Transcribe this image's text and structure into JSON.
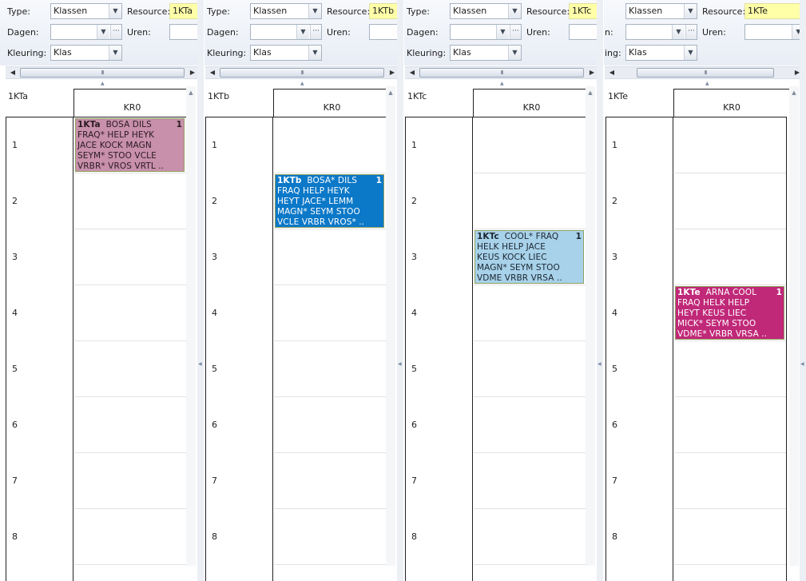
{
  "labels": {
    "type": "Type:",
    "resource": "Resource:",
    "dagen": "Dagen:",
    "uren": "Uren:",
    "kleuring": "Kleuring:"
  },
  "slots": [
    "1",
    "2",
    "3",
    "4",
    "5",
    "6",
    "7",
    "8"
  ],
  "panes": [
    {
      "type_value": "Klassen",
      "resource_value": "1KTa",
      "kleuring_value": "Klas",
      "resource_name": "1KTa",
      "column_header": "KR0",
      "lesson": {
        "slot_index": 0,
        "color": "#c890aa",
        "text_color": "#2a1a22",
        "class": "1KTa",
        "first_line": "BOSA  DILS",
        "count": "1",
        "lines": [
          "FRAQ*  HELP  HEYK",
          "JACE  KOCK  MAGN",
          "SEYM*  STOO  VCLE",
          "VRBR*  VROS  VRTL  .."
        ]
      }
    },
    {
      "type_value": "Klassen",
      "resource_value": "1KTb",
      "kleuring_value": "Klas",
      "resource_name": "1KTb",
      "column_header": "KR0",
      "lesson": {
        "slot_index": 1,
        "color": "#0b78c8",
        "text_color": "#ffffff",
        "class": "1KTb",
        "first_line": "BOSA*  DILS",
        "count": "1",
        "lines": [
          "FRAQ  HELP  HEYK",
          "HEYT  JACE*  LEMM",
          "MAGN*  SEYM  STOO",
          "VCLE  VRBR  VROS*  .."
        ]
      }
    },
    {
      "type_value": "Klassen",
      "resource_value": "1KTc",
      "kleuring_value": "Klas",
      "resource_name": "1KTc",
      "column_header": "KR0",
      "lesson": {
        "slot_index": 2,
        "color": "#a8d2ea",
        "text_color": "#1b2630",
        "class": "1KTc",
        "first_line": "COOL*  FRAQ",
        "count": "1",
        "lines": [
          "HELK  HELP  JACE",
          "KEUS  KOCK  LIEC",
          "MAGN*  SEYM  STOO",
          "VDME  VRBR  VRSA  .."
        ]
      }
    },
    {
      "type_value": "Klassen",
      "resource_value": "1KTe",
      "kleuring_value": "Klas",
      "resource_name": "1KTe",
      "column_header": "KR0",
      "lesson": {
        "slot_index": 3,
        "color": "#c02878",
        "text_color": "#ffffff",
        "class": "1KTe",
        "first_line": "ARNA  COOL",
        "count": "1",
        "lines": [
          "FRAQ  HELK  HELP",
          "HEYT  KEUS  LIEC",
          "MICK*  SEYM  STOO",
          "VDME*  VRBR  VRSA  .."
        ]
      }
    }
  ]
}
